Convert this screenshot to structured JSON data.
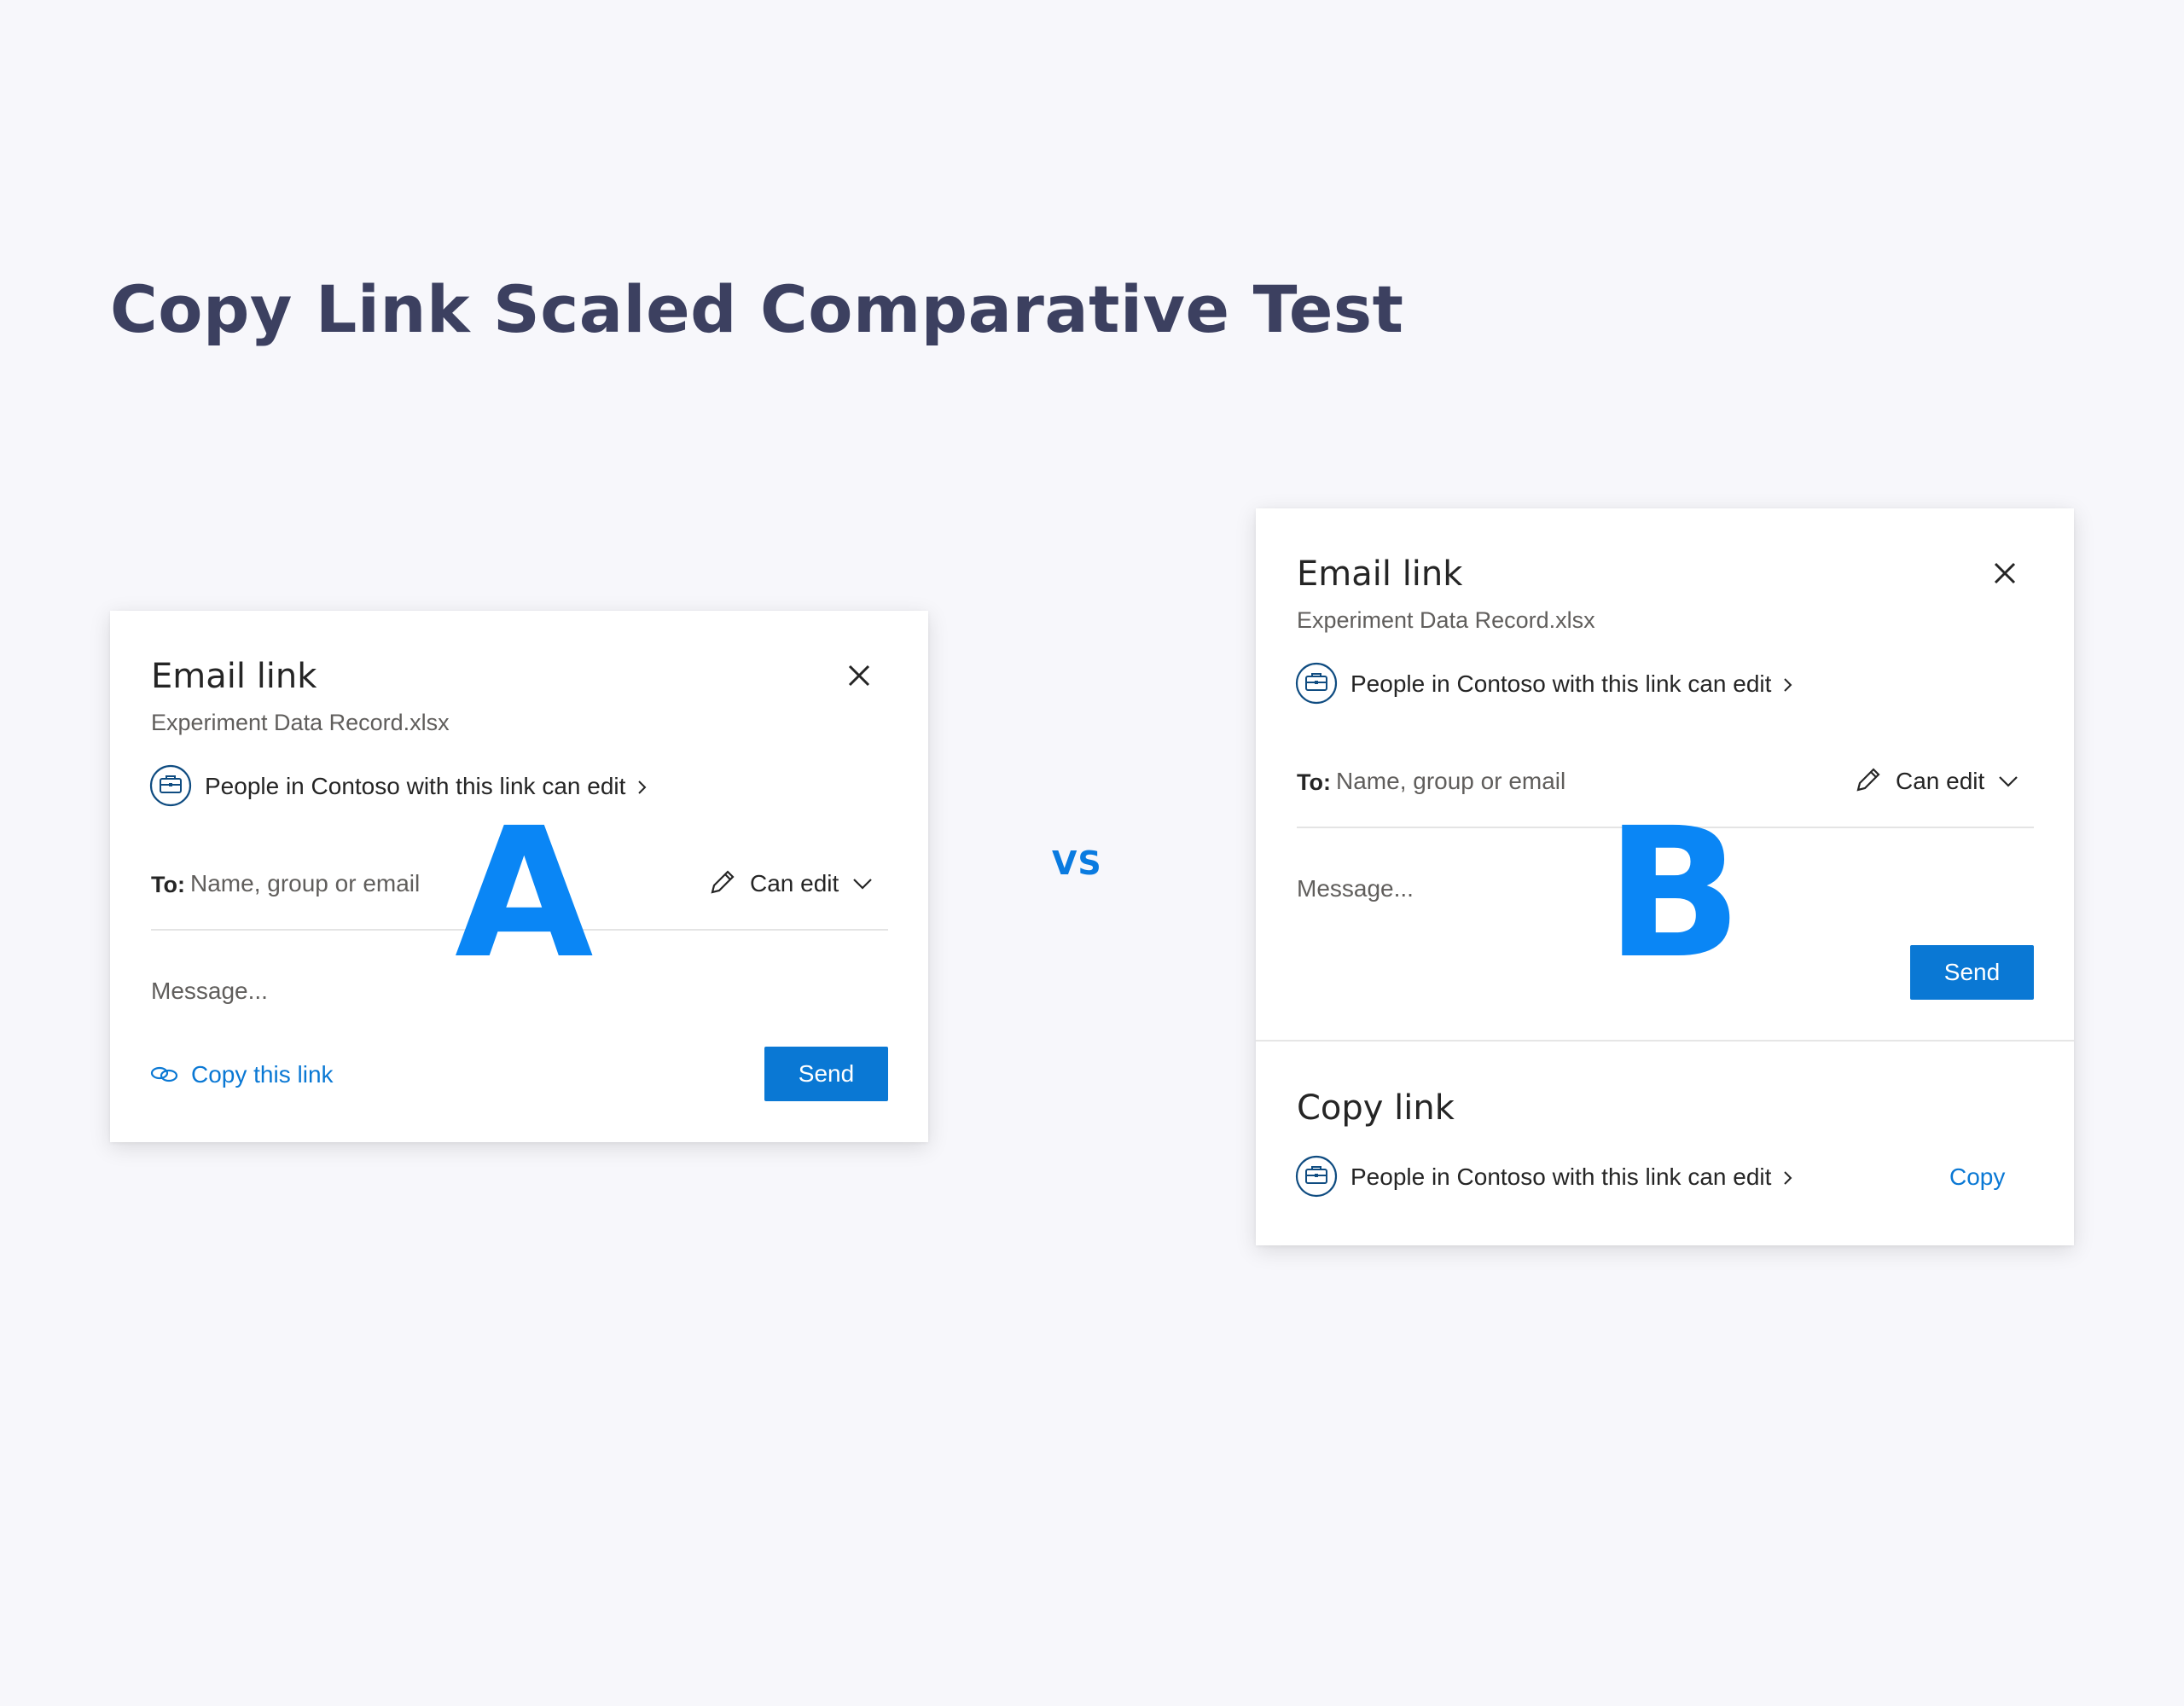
{
  "page": {
    "title": "Copy Link Scaled Comparative Test",
    "vs_label": "VS",
    "variant_a": "A",
    "variant_b": "B"
  },
  "card_a": {
    "title": "Email link",
    "filename": "Experiment Data Record.xlsx",
    "permission": "People in Contoso with this link can edit",
    "to_label": "To:",
    "to_placeholder": "Name, group or email",
    "access": "Can edit",
    "message_placeholder": "Message...",
    "copy_link_label": "Copy this link",
    "send_label": "Send"
  },
  "card_b": {
    "title": "Email link",
    "filename": "Experiment Data Record.xlsx",
    "permission": "People in Contoso with this link can edit",
    "to_label": "To:",
    "to_placeholder": "Name, group or email",
    "access": "Can edit",
    "message_placeholder": "Message...",
    "send_label": "Send",
    "copy_section_title": "Copy link",
    "copy_permission": "People in Contoso with this link can edit",
    "copy_label": "Copy"
  },
  "colors": {
    "background": "#F7F7FB",
    "title": "#3C4060",
    "accent": "#0A78D4",
    "variant_letter": "#0A86F5"
  },
  "icons": [
    "close-icon",
    "briefcase-icon",
    "chevron-right-icon",
    "pencil-icon",
    "chevron-down-icon",
    "link-icon"
  ]
}
